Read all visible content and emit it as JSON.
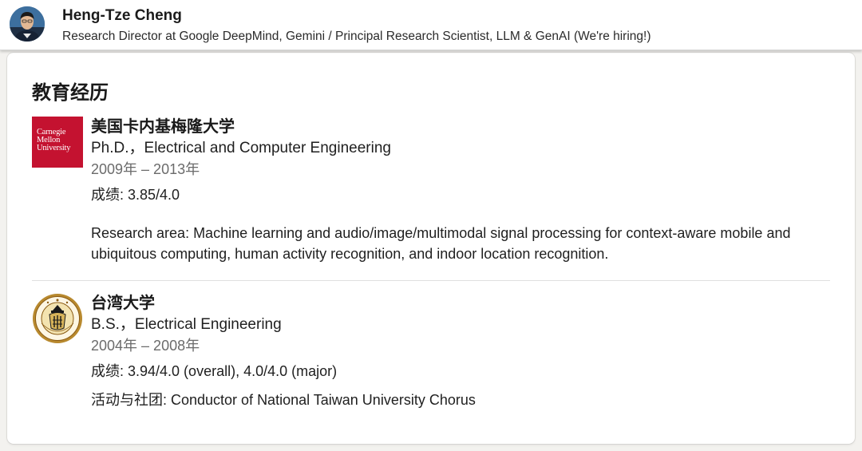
{
  "profile": {
    "name": "Heng-Tze Cheng",
    "headline": "Research Director at Google DeepMind, Gemini / Principal Research Scientist, LLM & GenAI (We're hiring!)"
  },
  "education": {
    "title": "教育经历",
    "entries": [
      {
        "school": "美国卡内基梅隆大学",
        "logo_text": [
          "Carnegie",
          "Mellon",
          "University"
        ],
        "logo_color": "#c41230",
        "degree": "Ph.D.，Electrical and Computer Engineering",
        "dates": "2009年 – 2013年",
        "grade": "成绩: 3.85/4.0",
        "description": "Research area: Machine learning and audio/image/multimodal signal processing for context-aware mobile and ubiquitous computing, human activity recognition, and indoor location recognition."
      },
      {
        "school": "台湾大学",
        "logo_icon": "ntu-seal-icon",
        "degree": "B.S.，Electrical Engineering",
        "dates": "2004年 – 2008年",
        "grade": "成绩: 3.94/4.0 (overall), 4.0/4.0 (major)",
        "activities": "活动与社团: Conductor of National Taiwan University Chorus"
      }
    ]
  },
  "colors": {
    "page_background": "#f3f2ef",
    "card_background": "#ffffff",
    "date_text": "#6b6b6b"
  }
}
